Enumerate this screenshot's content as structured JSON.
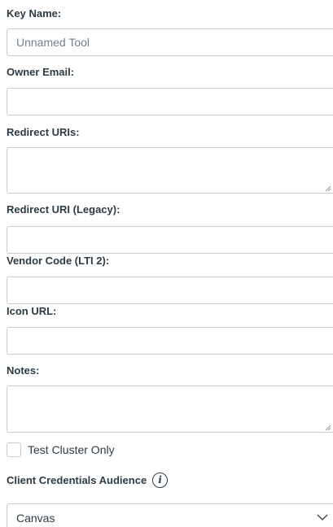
{
  "form": {
    "key_name": {
      "label": "Key Name:",
      "placeholder": "Unnamed Tool",
      "value": ""
    },
    "owner_email": {
      "label": "Owner Email:",
      "value": ""
    },
    "redirect_uris": {
      "label": "Redirect URIs:",
      "value": ""
    },
    "redirect_uri_legacy": {
      "label": "Redirect URI (Legacy):",
      "value": ""
    },
    "vendor_code": {
      "label": "Vendor Code (LTI 2):",
      "value": ""
    },
    "icon_url": {
      "label": "Icon URL:",
      "value": ""
    },
    "notes": {
      "label": "Notes:",
      "value": ""
    },
    "test_cluster_only": {
      "label": "Test Cluster Only",
      "checked": false
    },
    "client_credentials_audience": {
      "label": "Client Credentials Audience",
      "info_icon": "info-icon",
      "selected": "Canvas"
    }
  },
  "colors": {
    "text": "#2d3b45",
    "border": "#c7cdd1",
    "placeholder": "#73818c"
  }
}
